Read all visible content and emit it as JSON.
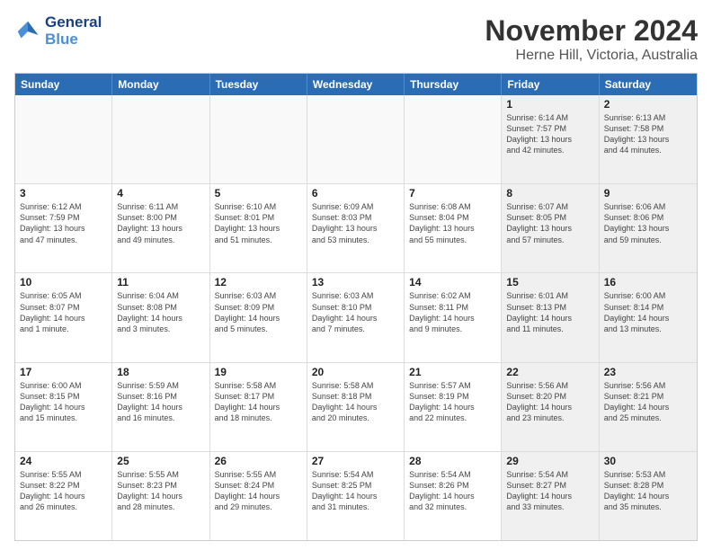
{
  "logo": {
    "line1": "General",
    "line2": "Blue"
  },
  "title": "November 2024",
  "subtitle": "Herne Hill, Victoria, Australia",
  "weekdays": [
    "Sunday",
    "Monday",
    "Tuesday",
    "Wednesday",
    "Thursday",
    "Friday",
    "Saturday"
  ],
  "rows": [
    [
      {
        "day": "",
        "text": ""
      },
      {
        "day": "",
        "text": ""
      },
      {
        "day": "",
        "text": ""
      },
      {
        "day": "",
        "text": ""
      },
      {
        "day": "",
        "text": ""
      },
      {
        "day": "1",
        "text": "Sunrise: 6:14 AM\nSunset: 7:57 PM\nDaylight: 13 hours\nand 42 minutes."
      },
      {
        "day": "2",
        "text": "Sunrise: 6:13 AM\nSunset: 7:58 PM\nDaylight: 13 hours\nand 44 minutes."
      }
    ],
    [
      {
        "day": "3",
        "text": "Sunrise: 6:12 AM\nSunset: 7:59 PM\nDaylight: 13 hours\nand 47 minutes."
      },
      {
        "day": "4",
        "text": "Sunrise: 6:11 AM\nSunset: 8:00 PM\nDaylight: 13 hours\nand 49 minutes."
      },
      {
        "day": "5",
        "text": "Sunrise: 6:10 AM\nSunset: 8:01 PM\nDaylight: 13 hours\nand 51 minutes."
      },
      {
        "day": "6",
        "text": "Sunrise: 6:09 AM\nSunset: 8:03 PM\nDaylight: 13 hours\nand 53 minutes."
      },
      {
        "day": "7",
        "text": "Sunrise: 6:08 AM\nSunset: 8:04 PM\nDaylight: 13 hours\nand 55 minutes."
      },
      {
        "day": "8",
        "text": "Sunrise: 6:07 AM\nSunset: 8:05 PM\nDaylight: 13 hours\nand 57 minutes."
      },
      {
        "day": "9",
        "text": "Sunrise: 6:06 AM\nSunset: 8:06 PM\nDaylight: 13 hours\nand 59 minutes."
      }
    ],
    [
      {
        "day": "10",
        "text": "Sunrise: 6:05 AM\nSunset: 8:07 PM\nDaylight: 14 hours\nand 1 minute."
      },
      {
        "day": "11",
        "text": "Sunrise: 6:04 AM\nSunset: 8:08 PM\nDaylight: 14 hours\nand 3 minutes."
      },
      {
        "day": "12",
        "text": "Sunrise: 6:03 AM\nSunset: 8:09 PM\nDaylight: 14 hours\nand 5 minutes."
      },
      {
        "day": "13",
        "text": "Sunrise: 6:03 AM\nSunset: 8:10 PM\nDaylight: 14 hours\nand 7 minutes."
      },
      {
        "day": "14",
        "text": "Sunrise: 6:02 AM\nSunset: 8:11 PM\nDaylight: 14 hours\nand 9 minutes."
      },
      {
        "day": "15",
        "text": "Sunrise: 6:01 AM\nSunset: 8:13 PM\nDaylight: 14 hours\nand 11 minutes."
      },
      {
        "day": "16",
        "text": "Sunrise: 6:00 AM\nSunset: 8:14 PM\nDaylight: 14 hours\nand 13 minutes."
      }
    ],
    [
      {
        "day": "17",
        "text": "Sunrise: 6:00 AM\nSunset: 8:15 PM\nDaylight: 14 hours\nand 15 minutes."
      },
      {
        "day": "18",
        "text": "Sunrise: 5:59 AM\nSunset: 8:16 PM\nDaylight: 14 hours\nand 16 minutes."
      },
      {
        "day": "19",
        "text": "Sunrise: 5:58 AM\nSunset: 8:17 PM\nDaylight: 14 hours\nand 18 minutes."
      },
      {
        "day": "20",
        "text": "Sunrise: 5:58 AM\nSunset: 8:18 PM\nDaylight: 14 hours\nand 20 minutes."
      },
      {
        "day": "21",
        "text": "Sunrise: 5:57 AM\nSunset: 8:19 PM\nDaylight: 14 hours\nand 22 minutes."
      },
      {
        "day": "22",
        "text": "Sunrise: 5:56 AM\nSunset: 8:20 PM\nDaylight: 14 hours\nand 23 minutes."
      },
      {
        "day": "23",
        "text": "Sunrise: 5:56 AM\nSunset: 8:21 PM\nDaylight: 14 hours\nand 25 minutes."
      }
    ],
    [
      {
        "day": "24",
        "text": "Sunrise: 5:55 AM\nSunset: 8:22 PM\nDaylight: 14 hours\nand 26 minutes."
      },
      {
        "day": "25",
        "text": "Sunrise: 5:55 AM\nSunset: 8:23 PM\nDaylight: 14 hours\nand 28 minutes."
      },
      {
        "day": "26",
        "text": "Sunrise: 5:55 AM\nSunset: 8:24 PM\nDaylight: 14 hours\nand 29 minutes."
      },
      {
        "day": "27",
        "text": "Sunrise: 5:54 AM\nSunset: 8:25 PM\nDaylight: 14 hours\nand 31 minutes."
      },
      {
        "day": "28",
        "text": "Sunrise: 5:54 AM\nSunset: 8:26 PM\nDaylight: 14 hours\nand 32 minutes."
      },
      {
        "day": "29",
        "text": "Sunrise: 5:54 AM\nSunset: 8:27 PM\nDaylight: 14 hours\nand 33 minutes."
      },
      {
        "day": "30",
        "text": "Sunrise: 5:53 AM\nSunset: 8:28 PM\nDaylight: 14 hours\nand 35 minutes."
      }
    ]
  ]
}
